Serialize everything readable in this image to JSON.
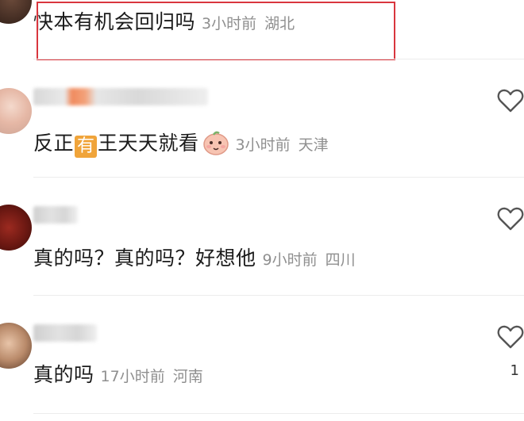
{
  "comments": [
    {
      "username": "",
      "content": "快本有机会回归吗",
      "time": "3小时前",
      "location": "湖北",
      "highlighted": true
    },
    {
      "username": "",
      "content_before": "反正",
      "content_badge": "有",
      "content_after": "王天天就看",
      "emoji": "peach-emoji",
      "time": "3小时前",
      "location": "天津",
      "like_icon": "heart-outline-icon"
    },
    {
      "username": "",
      "content": "真的吗？真的吗？好想他",
      "time": "9小时前",
      "location": "四川",
      "like_icon": "heart-outline-icon"
    },
    {
      "username": "",
      "content": "真的吗",
      "time": "17小时前",
      "location": "河南",
      "like_icon": "heart-outline-icon",
      "like_count": "1"
    }
  ],
  "colors": {
    "highlight_border": "#d9363e",
    "badge": "#f0a43a",
    "meta_text": "#8f8f8f"
  }
}
